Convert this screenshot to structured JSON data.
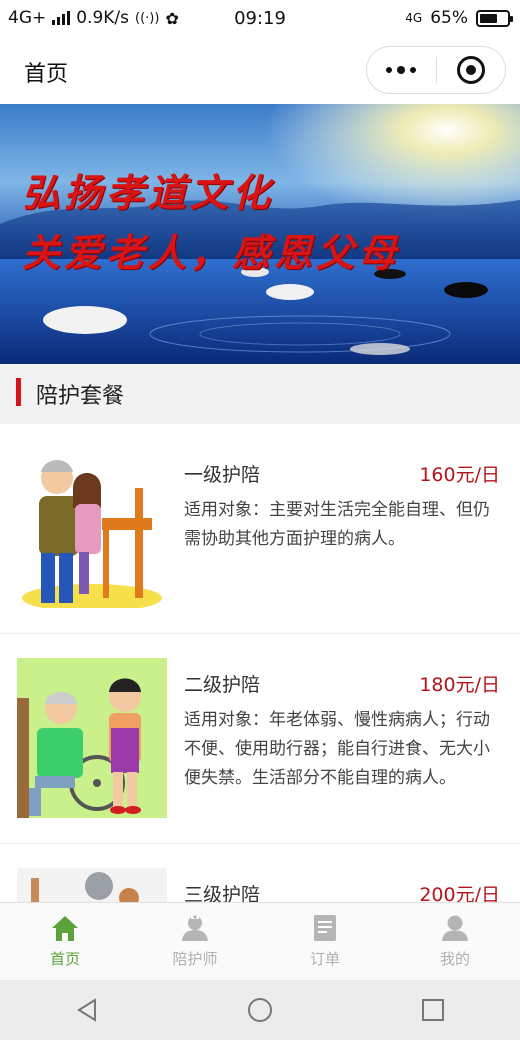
{
  "status_bar": {
    "network": "4G+",
    "speed": "0.9K/s",
    "time": "09:19",
    "net_right": "4G",
    "battery_text": "65%",
    "battery_level": 0.65
  },
  "navbar": {
    "title": "首页"
  },
  "banner": {
    "line1": "弘扬孝道文化",
    "line2": "关爱老人，感恩父母"
  },
  "section": {
    "title": "陪护套餐"
  },
  "packages": [
    {
      "name": "一级护陪",
      "price": "160元/日",
      "desc": "适用对象：主要对生活完全能自理、但仍需协助其他方面护理的病人。"
    },
    {
      "name": "二级护陪",
      "price": "180元/日",
      "desc": "适用对象：年老体弱、慢性病病人；行动不便、使用助行器；能自行进食、无大小便失禁。生活部分不能自理的病人。"
    },
    {
      "name": "三级护陪",
      "price": "200元/日",
      "desc": ""
    }
  ],
  "tabbar": {
    "items": [
      {
        "label": "首页",
        "icon": "home-icon",
        "active": true
      },
      {
        "label": "陪护师",
        "icon": "caregiver-icon",
        "active": false
      },
      {
        "label": "订单",
        "icon": "order-icon",
        "active": false
      },
      {
        "label": "我的",
        "icon": "user-icon",
        "active": false
      }
    ]
  },
  "colors": {
    "accent_green": "#5aa33a",
    "price_red": "#b3141a",
    "section_bar": "#d3141b"
  }
}
